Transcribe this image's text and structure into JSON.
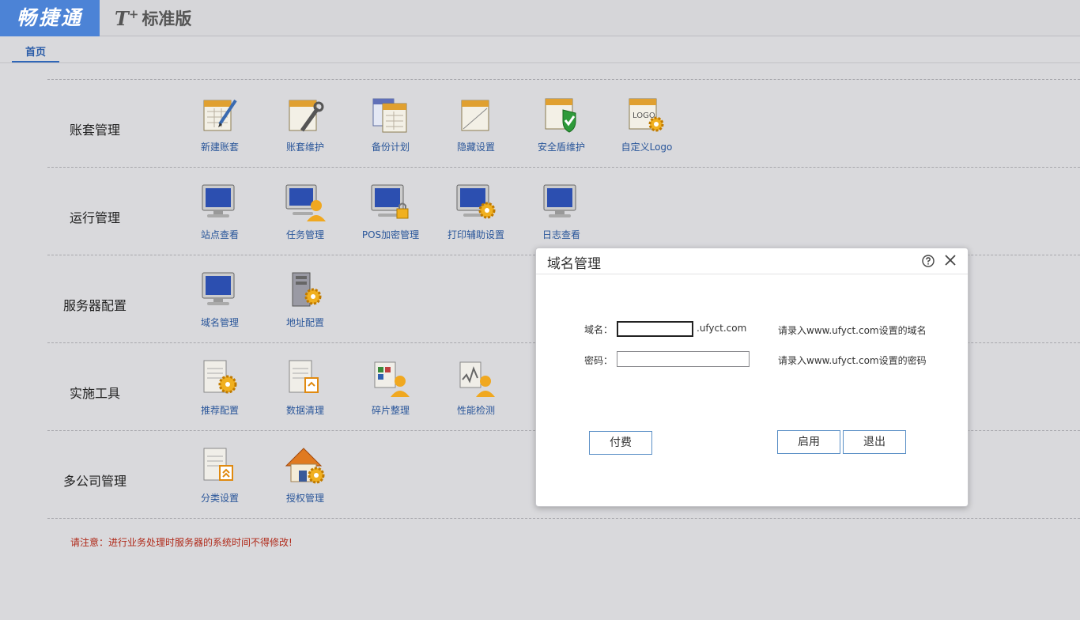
{
  "header": {
    "brand": "畅捷通",
    "edition_prefix": "T",
    "edition_sup": "+",
    "edition_name": "标准版"
  },
  "tabs": {
    "home": "首页"
  },
  "sections": [
    {
      "title": "账套管理",
      "tools": [
        {
          "label": "新建账套",
          "icon": "ledger-pencil-icon"
        },
        {
          "label": "账套维护",
          "icon": "ledger-wrench-icon"
        },
        {
          "label": "备份计划",
          "icon": "ledger-stack-icon"
        },
        {
          "label": "隐藏设置",
          "icon": "ledger-hidden-icon"
        },
        {
          "label": "安全盾维护",
          "icon": "ledger-shield-icon"
        },
        {
          "label": "自定义Logo",
          "icon": "logo-gear-icon"
        }
      ]
    },
    {
      "title": "运行管理",
      "tools": [
        {
          "label": "站点查看",
          "icon": "monitor-icon"
        },
        {
          "label": "任务管理",
          "icon": "monitor-user-icon"
        },
        {
          "label": "POS加密管理",
          "icon": "monitor-lock-icon"
        },
        {
          "label": "打印辅助设置",
          "icon": "monitor-gear-icon"
        },
        {
          "label": "日志查看",
          "icon": "monitor-icon"
        }
      ]
    },
    {
      "title": "服务器配置",
      "tools": [
        {
          "label": "域名管理",
          "icon": "monitor-icon"
        },
        {
          "label": "地址配置",
          "icon": "server-gear-icon"
        }
      ]
    },
    {
      "title": "实施工具",
      "tools": [
        {
          "label": "推荐配置",
          "icon": "doc-gear-icon"
        },
        {
          "label": "数据清理",
          "icon": "doc-stack-icon"
        },
        {
          "label": "碎片整理",
          "icon": "fragments-user-icon"
        },
        {
          "label": "性能检测",
          "icon": "chart-user-icon"
        }
      ]
    },
    {
      "title": "多公司管理",
      "tools": [
        {
          "label": "分类设置",
          "icon": "doc-category-icon"
        },
        {
          "label": "授权管理",
          "icon": "house-gear-icon"
        }
      ]
    }
  ],
  "notice": "请注意：进行业务处理时服务器的系统时间不得修改!",
  "dialog": {
    "title": "域名管理",
    "domain_label": "域名：",
    "domain_value": "",
    "domain_suffix": ".ufyct.com",
    "domain_hint": "请录入www.ufyct.com设置的域名",
    "password_label": "密码：",
    "password_value": "",
    "password_hint": "请录入www.ufyct.com设置的密码",
    "pay_button": "付费",
    "enable_button": "启用",
    "exit_button": "退出"
  },
  "colors": {
    "brand": "#4c83d6",
    "link": "#2a569a",
    "notice": "#b02a1a",
    "button_border": "#5a8fc6"
  }
}
